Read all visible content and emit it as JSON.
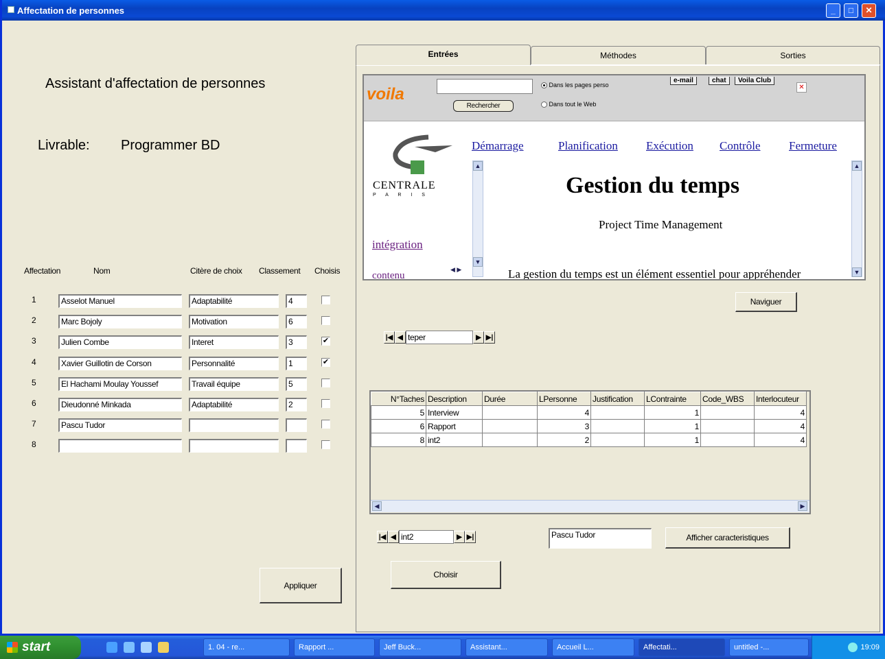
{
  "window": {
    "title": "Affectation de personnes"
  },
  "left": {
    "heading": "Assistant d'affectation de personnes",
    "livrable_label": "Livrable:",
    "livrable_value": "Programmer BD",
    "columns": [
      "Affectation",
      "Nom",
      "Citère de choix",
      "Classement",
      "Choisis"
    ],
    "rows": [
      {
        "idx": "1",
        "nom": "Asselot Manuel",
        "critere": "Adaptabilité",
        "classement": "4",
        "choisi": false
      },
      {
        "idx": "2",
        "nom": "Marc Bojoly",
        "critere": "Motivation",
        "classement": "6",
        "choisi": false
      },
      {
        "idx": "3",
        "nom": "Julien Combe",
        "critere": "Interet",
        "classement": "3",
        "choisi": true
      },
      {
        "idx": "4",
        "nom": "Xavier Guillotin de Corson",
        "critere": "Personnalité",
        "classement": "1",
        "choisi": true
      },
      {
        "idx": "5",
        "nom": "El Hachami Moulay Youssef",
        "critere": "Travail équipe",
        "classement": "5",
        "choisi": false
      },
      {
        "idx": "6",
        "nom": "Dieudonné Minkada",
        "critere": "Adaptabilité",
        "classement": "2",
        "choisi": false
      },
      {
        "idx": "7",
        "nom": "Pascu Tudor",
        "critere": "",
        "classement": "",
        "choisi": false
      },
      {
        "idx": "8",
        "nom": "",
        "critere": "",
        "classement": "",
        "choisi": false
      }
    ],
    "appliquer": "Appliquer"
  },
  "tabs": [
    "Entrées",
    "Méthodes",
    "Sorties"
  ],
  "browser": {
    "search_button": "Rechercher",
    "radio1": "Dans les pages perso",
    "radio2": "Dans tout le Web",
    "voila_tabs": [
      "e-mail",
      "chat",
      "Voila Club"
    ],
    "logo_text": "CENTRALE",
    "logo_sub": "P A R I S",
    "links": [
      "Démarrage",
      "Planification",
      "Exécution",
      "Contrôle",
      "Fermeture"
    ],
    "side_links": [
      "intégration",
      "contenu"
    ],
    "page_title": "Gestion du temps",
    "page_subtitle": "Project Time Management",
    "page_text": "La gestion du temps est un élément essentiel pour appréhender"
  },
  "naviguer": "Naviguer",
  "nav1_value": "teper",
  "grid": {
    "headers": [
      "N°Taches",
      "Description",
      "Durée",
      "LPersonne",
      "Justification",
      "LContrainte",
      "Code_WBS",
      "Interlocuteur"
    ],
    "rows": [
      [
        "5",
        "Interview",
        "",
        "4",
        "",
        "1",
        "",
        "4"
      ],
      [
        "6",
        "Rapport",
        "",
        "3",
        "",
        "1",
        "",
        "4"
      ],
      [
        "8",
        "int2",
        "",
        "2",
        "",
        "1",
        "",
        "4"
      ]
    ]
  },
  "nav2_value": "int2",
  "person_field": "Pascu Tudor",
  "afficher": "Afficher caracteristiques",
  "choisir": "Choisir",
  "taskbar": {
    "start": "start",
    "items": [
      "1. 04 - re...",
      "Rapport ...",
      "Jeff Buck...",
      "Assistant...",
      "Accueil L...",
      "Affectati...",
      "untitled -..."
    ],
    "clock": "19:09"
  }
}
